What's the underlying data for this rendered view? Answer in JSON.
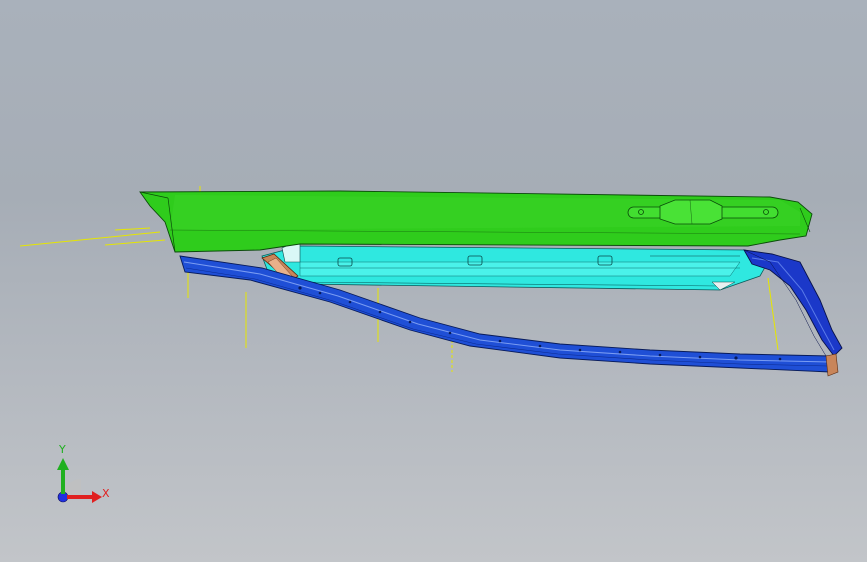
{
  "viewport": {
    "background_top": "#a9b1bb",
    "background_bottom": "#c2c5c9"
  },
  "model": {
    "parts": [
      {
        "name": "outer-door-panel",
        "color": "#2fcc1c"
      },
      {
        "name": "inner-door-panel",
        "color": "#2fe8e0"
      },
      {
        "name": "lower-sill-beam",
        "color": "#1f4fd6"
      },
      {
        "name": "rear-end-cap",
        "color": "#1b38c9"
      },
      {
        "name": "bracket",
        "color": "#c8855a"
      }
    ],
    "reference_line_color": "#e6e600"
  },
  "triad": {
    "x_label": "X",
    "y_label": "Y",
    "x_color": "#e02020",
    "y_color": "#20b020",
    "z_color": "#2030e0"
  }
}
